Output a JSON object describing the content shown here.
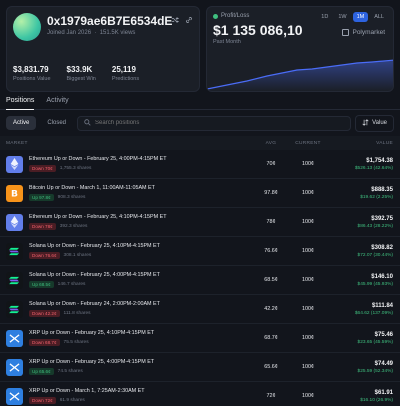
{
  "profile": {
    "address": "0x1979ae6B7E6534dE9...",
    "joined": "Joined Jan 2026",
    "views": "151.5K views",
    "stats": [
      {
        "value": "$3,831.79",
        "label": "Positions Value"
      },
      {
        "value": "$33.9K",
        "label": "Biggest Win"
      },
      {
        "value": "25,119",
        "label": "Predictions"
      }
    ]
  },
  "pnl": {
    "label": "Profit/Loss",
    "value": "$1 135 086,10",
    "period": "Past Month",
    "ranges": [
      "1D",
      "1W",
      "1M",
      "ALL"
    ],
    "active_range": "1M",
    "brand": "Polymarket",
    "chart_color": "#4a6cf7"
  },
  "tabs": [
    "Positions",
    "Activity"
  ],
  "filters": {
    "active": "Active",
    "closed": "Closed",
    "search_placeholder": "Search positions",
    "sort_label": "Value"
  },
  "columns": {
    "market": "MARKET",
    "avg": "AVG",
    "current": "CURRENT",
    "value": "VALUE"
  },
  "positions": [
    {
      "coin": "ETH",
      "title": "Ethereum Up or Down - February 25, 4:00PM-4:15PM ET",
      "side": "down",
      "badge": "Down 70¢",
      "shares": "1,755.3 shares",
      "avg": "70¢",
      "current": "100¢",
      "value": "$1,754.38",
      "pnl": "$526.13 (42.64%)"
    },
    {
      "coin": "BTC",
      "title": "Bitcoin Up or Down - March 1, 11:00AM-11:05AM ET",
      "side": "up",
      "badge": "Up 97.8¢",
      "shares": "908.3 shares",
      "avg": "97.8¢",
      "current": "100¢",
      "value": "$888.35",
      "pnl": "$19.62 (2.25%)"
    },
    {
      "coin": "ETH",
      "title": "Ethereum Up or Down - February 25, 4:10PM-4:15PM ET",
      "side": "down",
      "badge": "Down 78¢",
      "shares": "392.3 shares",
      "avg": "78¢",
      "current": "100¢",
      "value": "$392.75",
      "pnl": "$86.43 (28.22%)"
    },
    {
      "coin": "SOL",
      "title": "Solana Up or Down - February 25, 4:10PM-4:15PM ET",
      "side": "down",
      "badge": "Down 76.6¢",
      "shares": "308.1 shares",
      "avg": "76.6¢",
      "current": "100¢",
      "value": "$308.82",
      "pnl": "$72.07 (30.44%)"
    },
    {
      "coin": "SOL",
      "title": "Solana Up or Down - February 25, 4:00PM-4:15PM ET",
      "side": "up",
      "badge": "Up 68.5¢",
      "shares": "146.7 shares",
      "avg": "68.5¢",
      "current": "100¢",
      "value": "$146.10",
      "pnl": "$45.99 (45.93%)"
    },
    {
      "coin": "SOL",
      "title": "Solana Up or Down - February 24, 2:00PM-2:00AM ET",
      "side": "down",
      "badge": "Down 42.2¢",
      "shares": "111.8 shares",
      "avg": "42.2¢",
      "current": "100¢",
      "value": "$111.84",
      "pnl": "$64.62 (137.09%)"
    },
    {
      "coin": "XRP",
      "title": "XRP Up or Down - February 25, 4:10PM-4:15PM ET",
      "side": "down",
      "badge": "Down 68.7¢",
      "shares": "75.5 shares",
      "avg": "68.7¢",
      "current": "100¢",
      "value": "$75.46",
      "pnl": "$23.65 (45.59%)"
    },
    {
      "coin": "XRP",
      "title": "XRP Up or Down - February 25, 4:00PM-4:15PM ET",
      "side": "up",
      "badge": "Up 65.6¢",
      "shares": "74.5 shares",
      "avg": "65.6¢",
      "current": "100¢",
      "value": "$74.49",
      "pnl": "$25.59 (52.34%)"
    },
    {
      "coin": "XRP",
      "title": "XRP Up or Down - March 1, 7:25AM-2:30AM ET",
      "side": "down",
      "badge": "Down 72¢",
      "shares": "61.9 shares",
      "avg": "72¢",
      "current": "100¢",
      "value": "$61.91",
      "pnl": "$16.10 (26.9%)"
    }
  ],
  "coin_colors": {
    "ETH": "#627eea",
    "BTC": "#f7931a",
    "SOL": "#111418",
    "XRP": "#2e7fe0"
  }
}
